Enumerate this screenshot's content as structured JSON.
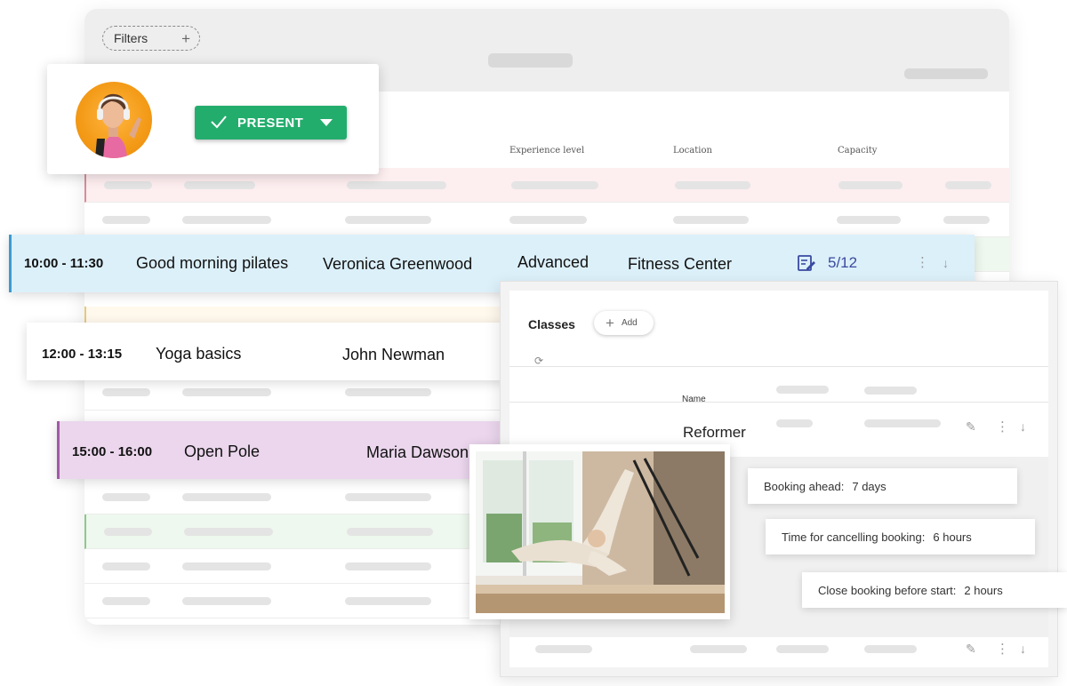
{
  "filters": {
    "label": "Filters"
  },
  "table": {
    "headers": {
      "experience": "Experience level",
      "location": "Location",
      "capacity": "Capacity"
    }
  },
  "attendee": {
    "status_label": "PRESENT",
    "status_color": "#23ad6d"
  },
  "classes_rows": [
    {
      "time": "10:00 - 11:30",
      "name": "Good morning pilates",
      "instructor": "Veronica Greenwood",
      "level": "Advanced",
      "location": "Fitness Center",
      "capacity": "5/12",
      "color": "#dcf0fa"
    },
    {
      "time": "12:00 - 13:15",
      "name": "Yoga basics",
      "instructor": "John Newman"
    },
    {
      "time": "15:00 - 16:00",
      "name": "Open Pole",
      "instructor": "Maria Dawson",
      "color": "#ebd6ed"
    }
  ],
  "classes_panel": {
    "title": "Classes",
    "add_label": "Add",
    "name_header": "Name",
    "class_name": "Reformer"
  },
  "settings": {
    "booking_ahead": {
      "label": "Booking ahead:",
      "value": "7 days"
    },
    "cancel_time": {
      "label": "Time for cancelling booking:",
      "value": "6 hours"
    },
    "close_before": {
      "label": "Close booking before start:",
      "value": "2 hours"
    }
  },
  "icons": {
    "filter_add": "plus-icon",
    "status_check": "check-icon",
    "status_dropdown": "caret-down-icon",
    "capacity": "notes-icon",
    "row_menu": "kebab-icon",
    "row_expand": "arrow-down-icon",
    "refresh": "refresh-icon",
    "edit": "pencil-icon"
  }
}
